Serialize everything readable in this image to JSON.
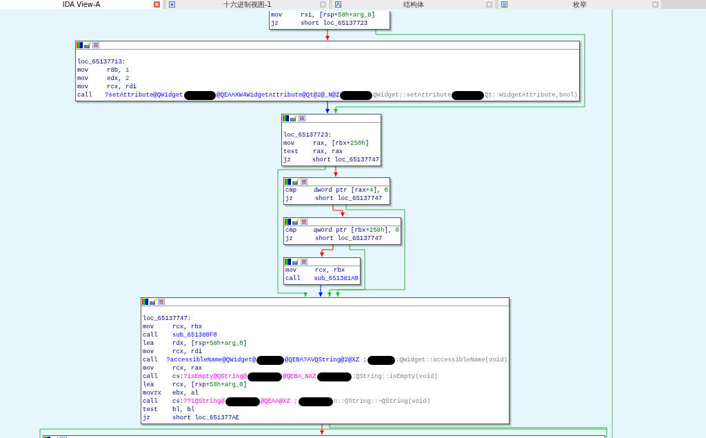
{
  "tabs": [
    {
      "label": "IDA View-A",
      "selected": true
    },
    {
      "label": "十六进制视图-1",
      "selected": false
    },
    {
      "label": "结构体",
      "selected": false
    },
    {
      "label": "枚举",
      "selected": false
    }
  ],
  "blocks": [
    {
      "lines": [
        {
          "kind": "instr",
          "mnemonic": "mov",
          "operands": [
            {
              "text": "rsi, [rsp+",
              "kind": "plain"
            },
            {
              "text": "58h",
              "kind": "num"
            },
            {
              "text": "+",
              "kind": "plain"
            },
            {
              "text": "arg_8",
              "kind": "num"
            },
            {
              "text": "]",
              "kind": "plain"
            }
          ]
        },
        {
          "kind": "instr",
          "mnemonic": "jz",
          "operands": [
            {
              "text": "short loc_65137723",
              "kind": "plain"
            }
          ]
        }
      ]
    },
    {
      "lines": [
        {
          "kind": "label",
          "text": "loc_65137713:"
        },
        {
          "kind": "instr",
          "mnemonic": "mov",
          "operands": [
            {
              "text": "r8b, ",
              "kind": "plain"
            },
            {
              "text": "1",
              "kind": "num"
            }
          ]
        },
        {
          "kind": "instr",
          "mnemonic": "mov",
          "operands": [
            {
              "text": "edx, ",
              "kind": "plain"
            },
            {
              "text": "2",
              "kind": "num"
            }
          ]
        },
        {
          "kind": "instr",
          "mnemonic": "mov",
          "operands": [
            {
              "text": "rcx, rdi",
              "kind": "plain"
            }
          ]
        },
        {
          "kind": "instr",
          "mnemonic": "call",
          "operands": [
            {
              "text": "?setAttribute@QWidget",
              "kind": "name"
            },
            {
              "kind": "redaction"
            },
            {
              "text": "@QEAAXW4WidgetAttribute@Qt@2@_N@Z",
              "kind": "name"
            },
            {
              "kind": "redaction"
            },
            {
              "text": "QWidget::setAttribute",
              "kind": "comment"
            },
            {
              "kind": "redaction"
            },
            {
              "text": "Qt::WidgetAttribute,bool)",
              "kind": "comment"
            }
          ]
        }
      ]
    },
    {
      "lines": [
        {
          "kind": "label",
          "text": "loc_65137723:"
        },
        {
          "kind": "instr",
          "mnemonic": "mov",
          "operands": [
            {
              "text": "rax, [rbx+",
              "kind": "plain"
            },
            {
              "text": "250h",
              "kind": "num"
            },
            {
              "text": "]",
              "kind": "plain"
            }
          ]
        },
        {
          "kind": "instr",
          "mnemonic": "test",
          "operands": [
            {
              "text": "rax, rax",
              "kind": "plain"
            }
          ]
        },
        {
          "kind": "instr",
          "mnemonic": "jz",
          "operands": [
            {
              "text": "short loc_65137747",
              "kind": "plain"
            }
          ]
        }
      ]
    },
    {
      "lines": [
        {
          "kind": "instr",
          "mnemonic": "cmp",
          "operands": [
            {
              "text": "dword ptr [rax+",
              "kind": "plain"
            },
            {
              "text": "4",
              "kind": "num"
            },
            {
              "text": "], ",
              "kind": "plain"
            },
            {
              "text": "0",
              "kind": "num"
            }
          ]
        },
        {
          "kind": "instr",
          "mnemonic": "jz",
          "operands": [
            {
              "text": "short loc_65137747",
              "kind": "plain"
            }
          ]
        }
      ]
    },
    {
      "lines": [
        {
          "kind": "instr",
          "mnemonic": "cmp",
          "operands": [
            {
              "text": "qword ptr [rbx+",
              "kind": "plain"
            },
            {
              "text": "258h",
              "kind": "num"
            },
            {
              "text": "], ",
              "kind": "plain"
            },
            {
              "text": "0",
              "kind": "num"
            }
          ]
        },
        {
          "kind": "instr",
          "mnemonic": "jz",
          "operands": [
            {
              "text": "short loc_65137747",
              "kind": "plain"
            }
          ]
        }
      ]
    },
    {
      "lines": [
        {
          "kind": "instr",
          "mnemonic": "mov",
          "operands": [
            {
              "text": "rcx, rbx",
              "kind": "plain"
            }
          ]
        },
        {
          "kind": "instr",
          "mnemonic": "call",
          "operands": [
            {
              "text": "sub_651381A0",
              "kind": "name"
            }
          ]
        }
      ]
    },
    {
      "lines": [
        {
          "kind": "label",
          "text": "loc_65137747:"
        },
        {
          "kind": "instr",
          "mnemonic": "mov",
          "operands": [
            {
              "text": "rcx, rbx",
              "kind": "plain"
            }
          ]
        },
        {
          "kind": "instr",
          "mnemonic": "call",
          "operands": [
            {
              "text": "sub_651380F0",
              "kind": "name"
            }
          ]
        },
        {
          "kind": "instr",
          "mnemonic": "lea",
          "operands": [
            {
              "text": "rdx, [rsp+",
              "kind": "plain"
            },
            {
              "text": "58h",
              "kind": "num"
            },
            {
              "text": "+",
              "kind": "plain"
            },
            {
              "text": "arg_0",
              "kind": "num"
            },
            {
              "text": "]",
              "kind": "plain"
            }
          ]
        },
        {
          "kind": "instr",
          "mnemonic": "mov",
          "operands": [
            {
              "text": "rcx, rdi",
              "kind": "plain"
            }
          ]
        },
        {
          "kind": "instr",
          "mnemonic": "call",
          "operands": [
            {
              "text": "?accessibleName@QWidget@",
              "kind": "name"
            },
            {
              "kind": "redaction"
            },
            {
              "text": "@QEBA?AVQString@2@XZ ;",
              "kind": "name"
            },
            {
              "kind": "redaction"
            },
            {
              "text": ":QWidget::accessibleName(void)",
              "kind": "comment"
            }
          ]
        },
        {
          "kind": "instr",
          "mnemonic": "mov",
          "operands": [
            {
              "text": "rcx, rax",
              "kind": "plain"
            }
          ]
        },
        {
          "kind": "instr",
          "mnemonic": "call",
          "operands": [
            {
              "text": "cs:",
              "kind": "plain"
            },
            {
              "text": "?isEmpty@QString@",
              "kind": "import"
            },
            {
              "kind": "redaction"
            },
            {
              "text": "@QEBA_NXZ",
              "kind": "import"
            },
            {
              "kind": "redaction"
            },
            {
              "text": ":QString::isEmpty(void)",
              "kind": "comment"
            }
          ]
        },
        {
          "kind": "instr",
          "mnemonic": "lea",
          "operands": [
            {
              "text": "rcx, [rsp+",
              "kind": "plain"
            },
            {
              "text": "58h",
              "kind": "num"
            },
            {
              "text": "+",
              "kind": "plain"
            },
            {
              "text": "arg_0",
              "kind": "num"
            },
            {
              "text": "]",
              "kind": "plain"
            }
          ]
        },
        {
          "kind": "instr",
          "mnemonic": "movzx",
          "operands": [
            {
              "text": "ebx, al",
              "kind": "plain"
            }
          ]
        },
        {
          "kind": "instr",
          "mnemonic": "call",
          "operands": [
            {
              "text": "cs:",
              "kind": "plain"
            },
            {
              "text": "??1QString@",
              "kind": "import"
            },
            {
              "kind": "redaction"
            },
            {
              "text": "@QEAA@XZ ;",
              "kind": "import"
            },
            {
              "kind": "redaction"
            },
            {
              "text": "n::QString::~QString(void)",
              "kind": "comment"
            }
          ]
        },
        {
          "kind": "instr",
          "mnemonic": "test",
          "operands": [
            {
              "text": "bl, bl",
              "kind": "plain"
            }
          ]
        },
        {
          "kind": "instr",
          "mnemonic": "jz",
          "operands": [
            {
              "text": "short loc_651377AE",
              "kind": "plain"
            }
          ]
        }
      ]
    }
  ]
}
